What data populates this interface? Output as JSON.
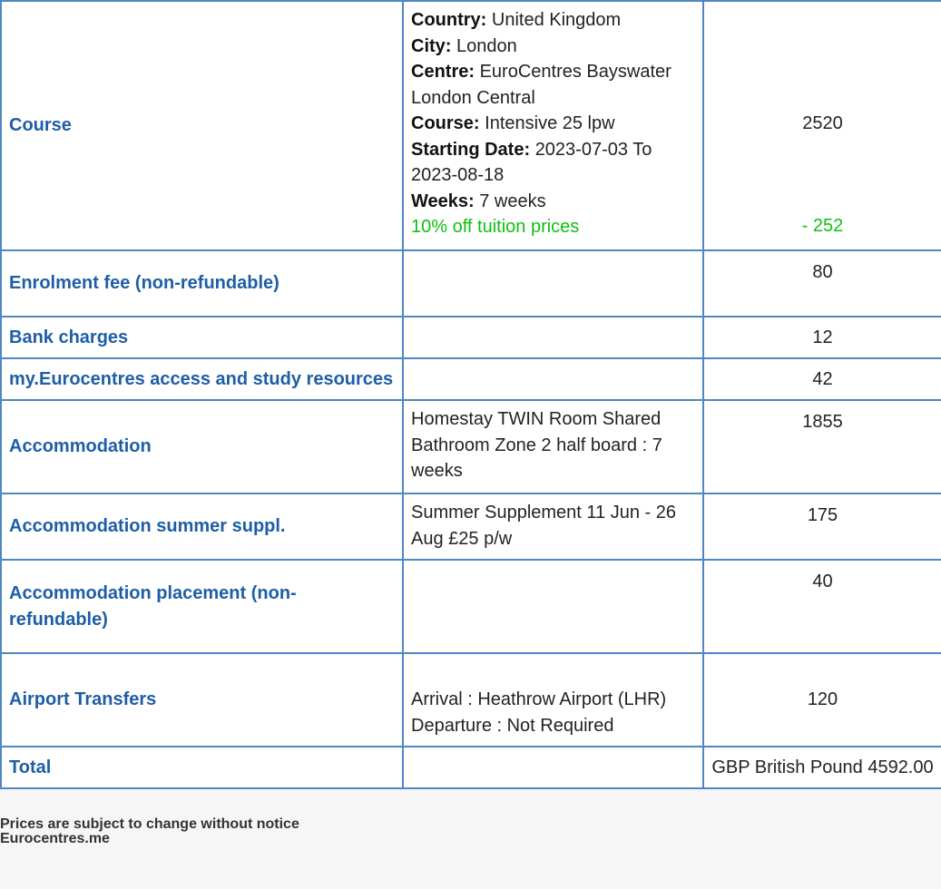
{
  "rows": {
    "course": {
      "label": "Course",
      "details": {
        "country_label": "Country:",
        "country": "United Kingdom",
        "city_label": "City:",
        "city": "London",
        "centre_label": "Centre:",
        "centre": "EuroCentres Bayswater London Central",
        "course_label": "Course:",
        "course": "Intensive 25 lpw",
        "starting_label": "Starting Date:",
        "starting": "2023-07-03 To 2023-08-18",
        "weeks_label": "Weeks:",
        "weeks": "7 weeks",
        "discount_note": "10% off tuition prices"
      },
      "price": "2520",
      "discount": "- 252"
    },
    "enrolment": {
      "label": "Enrolment fee (non-refundable)",
      "price": "80"
    },
    "bank": {
      "label": "Bank charges",
      "price": "12"
    },
    "resources": {
      "label": "my.Eurocentres access and study resources",
      "price": "42"
    },
    "accommodation": {
      "label": "Accommodation",
      "detail": "Homestay TWIN Room Shared Bathroom Zone 2 half board : 7 weeks",
      "price": "1855"
    },
    "summer": {
      "label": "Accommodation summer suppl.",
      "detail": "Summer Supplement 11 Jun - 26 Aug £25 p/w",
      "price": "175"
    },
    "placement": {
      "label": "Accommodation placement (non-refundable)",
      "price": "40"
    },
    "airport": {
      "label": "Airport Transfers",
      "arrival": "Arrival : Heathrow Airport (LHR)",
      "departure": "Departure : Not Required",
      "price": "120"
    },
    "total": {
      "label": "Total",
      "price": "GBP British Pound 4592.00"
    }
  },
  "footer": {
    "notice": "Prices are subject to change without notice",
    "site": "Eurocentres.me"
  },
  "colors": {
    "label_blue": "#1e5ea6",
    "border_blue": "#4f86c3",
    "discount_green": "#10c010"
  }
}
